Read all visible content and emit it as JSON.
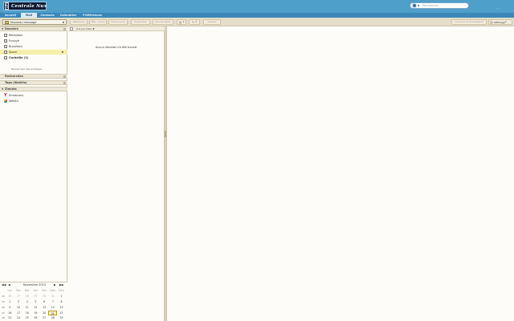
{
  "header": {
    "logo_text": "Centrale Nux",
    "search_placeholder": "Rechercher",
    "user_name": "...........",
    "colors": {
      "header_bg": "#4e9fca",
      "tab_bar": "#3a87b8",
      "toolbar_bg": "#e3ddc9",
      "selected_folder": "#f6efaa"
    }
  },
  "tabs": [
    {
      "label": "Accueil"
    },
    {
      "label": "Mail"
    },
    {
      "label": "Contacts"
    },
    {
      "label": "Calendrier"
    },
    {
      "label": "Préférences"
    }
  ],
  "toolbar": {
    "new_message": "Nouveau message",
    "buttons": [
      "Répondre",
      "Rép. à tous",
      "Faire suivre",
      "Supprimer",
      "Pas de spam",
      "Actions"
    ],
    "view_label": "Lire pour la messagerie",
    "reading_pane": "Affichage"
  },
  "sidebar": {
    "folders_title": "Dossiers",
    "folders": [
      {
        "label": "Réception",
        "icon": "inbox-icon"
      },
      {
        "label": "Envoyé",
        "icon": "sent-icon"
      },
      {
        "label": "Brouillons",
        "icon": "drafts-icon"
      },
      {
        "label": "Spam",
        "icon": "spam-icon"
      },
      {
        "label": "Corbeille (1)",
        "icon": "trash-icon"
      }
    ],
    "share_link": "Rechercher des partages...",
    "searches_title": "Recherches",
    "tags_title": "Tags (libellés)",
    "zimlets_title": "Zimlets",
    "zimlets": [
      {
        "label": "Emoticons",
        "icon": "yahoo-emoticons-icon"
      },
      {
        "label": "WebEx",
        "icon": "webex-icon"
      }
    ]
  },
  "calendar": {
    "month_title": "Novembre 2015",
    "day_headers": [
      "Lun",
      "Mar",
      "Mer",
      "Jeu",
      "Ven",
      "Sam",
      "Dim"
    ],
    "weeks": [
      {
        "week": "44",
        "days": [
          "26",
          "27",
          "28",
          "29",
          "30",
          "31",
          "1"
        ]
      },
      {
        "week": "45",
        "days": [
          "2",
          "3",
          "4",
          "5",
          "6",
          "7",
          "8"
        ]
      },
      {
        "week": "46",
        "days": [
          "9",
          "10",
          "11",
          "12",
          "13",
          "14",
          "15"
        ]
      },
      {
        "week": "47",
        "days": [
          "16",
          "17",
          "18",
          "19",
          "20",
          "21",
          "22"
        ]
      },
      {
        "week": "48",
        "days": [
          "23",
          "24",
          "25",
          "26",
          "27",
          "28",
          "29"
        ]
      }
    ],
    "today": "21"
  },
  "message_list": {
    "sort_label": "Trié par Date",
    "empty_text": "Aucun résultat n'a été trouvé."
  }
}
